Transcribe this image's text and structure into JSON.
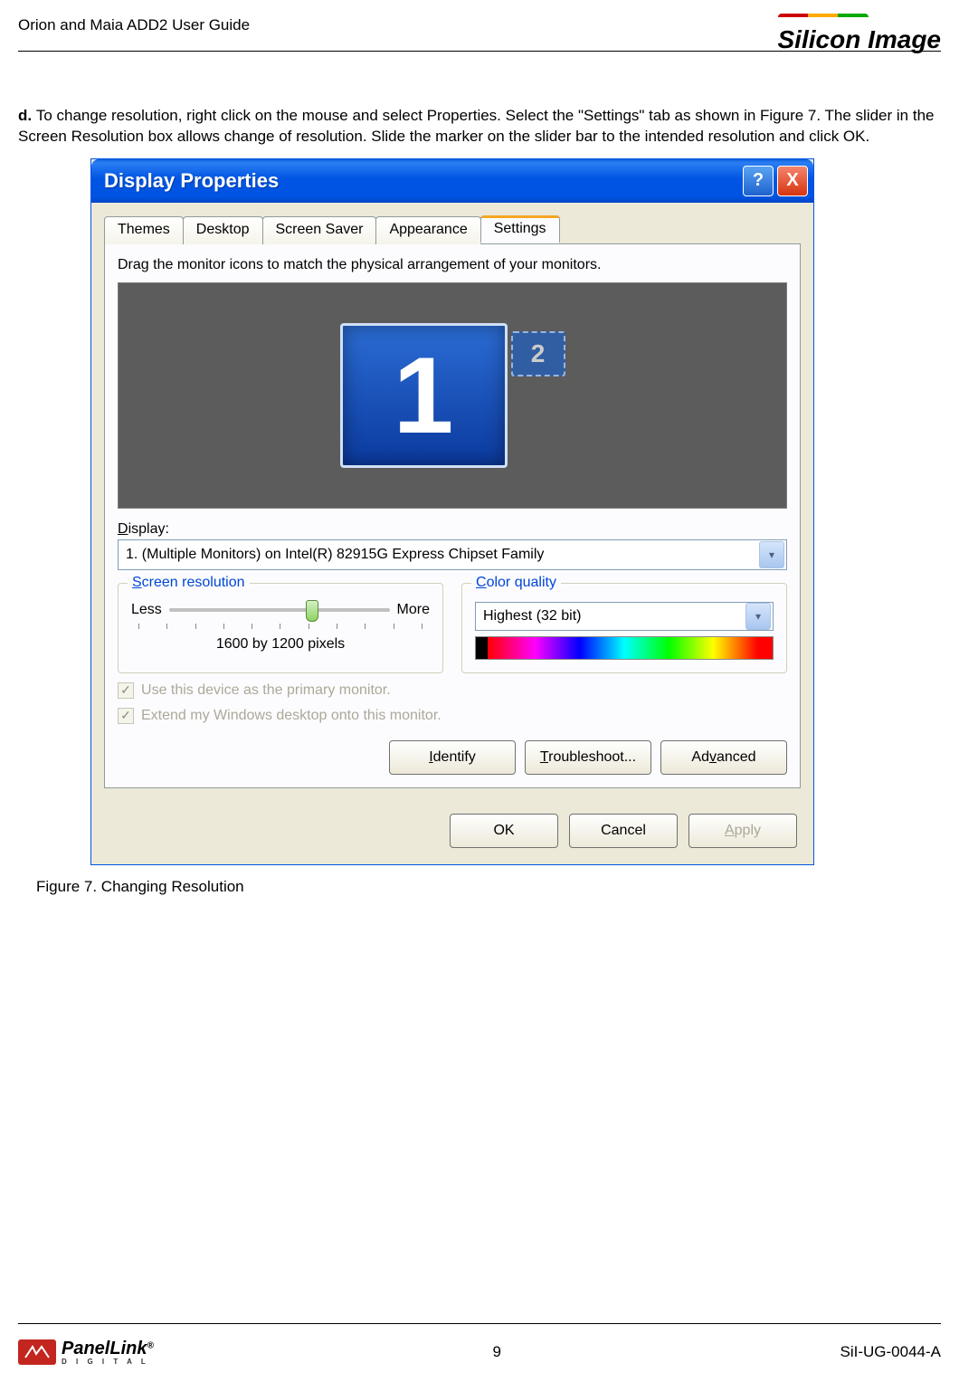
{
  "header": {
    "doc_title": "Orion and Maia ADD2 User Guide",
    "brand": "Silicon Image"
  },
  "instruction": {
    "label": "d.",
    "text": "To change resolution, right click on the mouse and select Properties. Select the \"Settings\" tab as shown in Figure 7. The slider in the Screen Resolution box allows change of resolution.  Slide the marker on the slider bar to the intended resolution and click OK."
  },
  "dialog": {
    "title": "Display Properties",
    "help": "?",
    "close": "X",
    "tabs": {
      "themes": "Themes",
      "desktop": "Desktop",
      "screensaver": "Screen Saver",
      "appearance": "Appearance",
      "settings": "Settings"
    },
    "hint": "Drag the monitor icons to match the physical arrangement of your monitors.",
    "monitors": {
      "one": "1",
      "two": "2"
    },
    "display_label": "Display:",
    "display_value": "1. (Multiple Monitors) on Intel(R) 82915G Express Chipset Family",
    "screen_res": {
      "title": "Screen resolution",
      "less": "Less",
      "more": "More",
      "value": "1600 by 1200 pixels"
    },
    "color_quality": {
      "title": "Color quality",
      "value": "Highest (32 bit)"
    },
    "opts": {
      "primary": "Use this device as the primary monitor.",
      "extend": "Extend my Windows desktop onto this monitor."
    },
    "buttons": {
      "identify": "Identify",
      "troubleshoot": "Troubleshoot...",
      "advanced": "Advanced",
      "ok": "OK",
      "cancel": "Cancel",
      "apply": "Apply"
    }
  },
  "caption": "Figure 7. Changing Resolution",
  "footer": {
    "logo": "PanelLink",
    "logo_sub": "D I G I T A L",
    "page": "9",
    "docnum": "SiI-UG-0044-A"
  }
}
